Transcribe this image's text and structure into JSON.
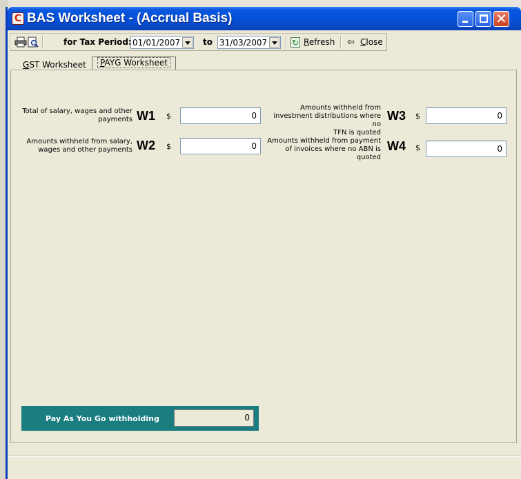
{
  "window": {
    "title": "BAS Worksheet - (Accrual Basis)",
    "icon_letter": "C"
  },
  "toolbar": {
    "tax_period_label": "for Tax Period:",
    "from_date": "01/01/2007",
    "to_label": "to",
    "to_date": "31/03/2007",
    "refresh_accel": "R",
    "refresh_rest": "efresh",
    "close_accel": "C",
    "close_rest": "lose",
    "icons": [
      "printer-icon",
      "print-preview-icon",
      "refresh-icon",
      "back-arrow-icon"
    ]
  },
  "tabs": [
    {
      "accel": "G",
      "rest": "ST Worksheet",
      "active": false
    },
    {
      "accel": "P",
      "rest": "AYG Worksheet",
      "active": true
    }
  ],
  "fields": {
    "w1": {
      "desc1": "Total of salary, wages and other",
      "desc2": "payments",
      "code": "W1",
      "currency": "$",
      "value": "0"
    },
    "w2": {
      "desc1": "Amounts withheld from salary,",
      "desc2": "wages and other payments",
      "code": "W2",
      "currency": "$",
      "value": "0"
    },
    "w3": {
      "desc1": "Amounts withheld from",
      "desc2": "investment distributions where no",
      "desc3": "TFN is quoted",
      "code": "W3",
      "currency": "$",
      "value": "0"
    },
    "w4": {
      "desc1": "Amounts withheld from payment",
      "desc2": "of invoices where no ABN is",
      "desc3": "quoted",
      "code": "W4",
      "currency": "$",
      "value": "0"
    }
  },
  "total": {
    "label": "Pay As You Go withholding",
    "value": "0"
  },
  "colors": {
    "title_bar": "#0450d8",
    "total_box": "#1a7e80",
    "window_bg": "#ece9d8"
  }
}
